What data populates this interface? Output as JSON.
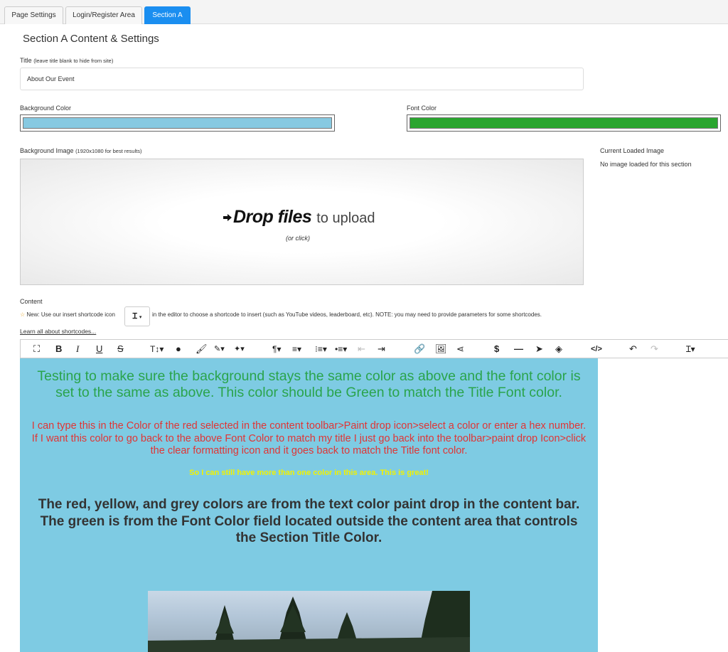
{
  "tabs": [
    {
      "label": "Page Settings"
    },
    {
      "label": "Login/Register Area"
    },
    {
      "label": "Section A"
    }
  ],
  "section_heading": "Section A Content & Settings",
  "title_field": {
    "label": "Title",
    "hint": "(leave title blank to hide from site)",
    "value": "About Our Event"
  },
  "background_color": {
    "label": "Background Color",
    "value": "#87c9e1"
  },
  "font_color": {
    "label": "Font Color",
    "value": "#2aa52f"
  },
  "background_image": {
    "label": "Background Image",
    "hint": "(1920x1080 for best results)",
    "drop_bold": "Drop files",
    "drop_rest": "to upload",
    "drop_sub": "(or click)"
  },
  "current_image": {
    "label": "Current Loaded Image",
    "status": "No image loaded for this section"
  },
  "content": {
    "label": "Content",
    "new_note_prefix": "New: Use our insert shortcode icon",
    "new_note_suffix": "in the editor to choose a shortcode to insert (such as YouTube videos, leaderboard, etc). NOTE: you may need to provide parameters for some shortcodes.",
    "learn_link": "Learn all about shortcodes..."
  },
  "toolbar_icons": [
    "fullscreen-icon",
    "bold-icon",
    "italic-icon",
    "underline-icon",
    "strikethrough-icon",
    "font-size-icon",
    "text-color-icon",
    "brush-icon",
    "highlight-icon",
    "magic-icon",
    "paragraph-icon",
    "align-icon",
    "ordered-list-icon",
    "unordered-list-icon",
    "outdent-icon",
    "indent-icon",
    "link-icon",
    "image-icon",
    "share-icon",
    "dollar-icon",
    "horizontal-line-icon",
    "cursor-icon",
    "eraser-icon",
    "code-view-icon",
    "undo-icon",
    "redo-icon",
    "shortcode-icon"
  ],
  "editor": {
    "background": "#7ecbe3",
    "green_text": "Testing to make sure the background stays the same color as above and the font color is set to the same as above. This color should be Green to match the Title Font color.",
    "red_text": "I can type this in the Color of the red selected in the content toolbar>Paint drop icon>select a color or enter a hex number. If I want this color to go back to the above Font Color to match my title I just go back into the toolbar>paint drop Icon>click the clear formatting icon and it goes back to match the Title font color.",
    "yellow_text": "So I can still have more than one color in this area. This is great!",
    "grey_text": "The red, yellow, and grey colors are from the text color paint drop in the content bar. The green is from the Font Color field located outside the content area that controls the Section Title Color."
  }
}
